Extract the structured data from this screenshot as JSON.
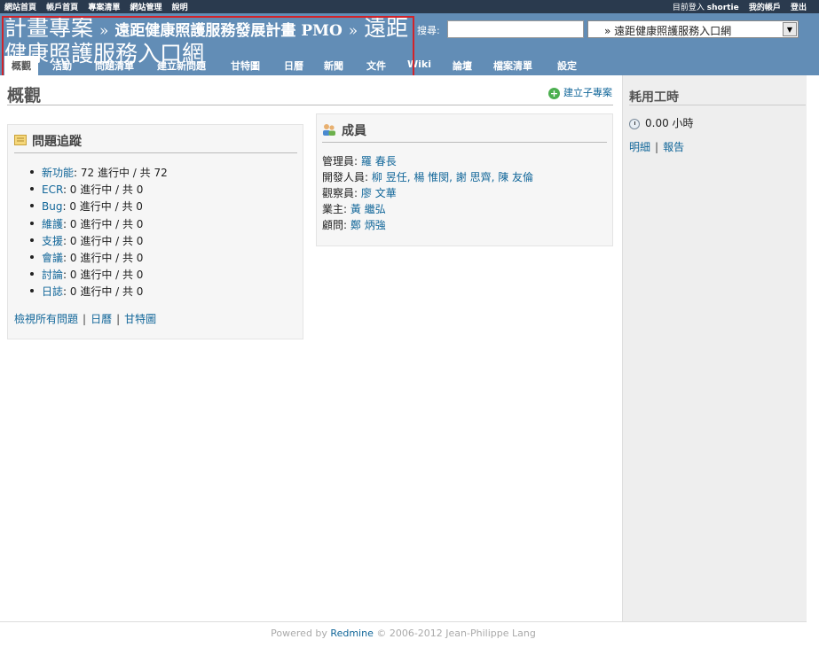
{
  "top_menu": {
    "left": [
      "網站首頁",
      "帳戶首頁",
      "專案清單",
      "網站管理",
      "說明"
    ],
    "logged_in_label": "目前登入",
    "username": "shortie",
    "my_account": "我的帳戶",
    "sign_out": "登出"
  },
  "header": {
    "breadcrumb_root": "計畫專案",
    "separator_1": "»",
    "parent_project": "遠距健康照護服務發展計畫 PMO",
    "separator_2": "»",
    "current_project": "遠距健康照護服務入口網",
    "search_label": "搜尋:",
    "search_value": "",
    "project_jump_value": "» 遠距健康照護服務入口網",
    "jump_arrow": "▼"
  },
  "tabs": [
    "概觀",
    "活動",
    "問題清單",
    "建立新問題",
    "甘特圖",
    "日曆",
    "新聞",
    "文件",
    "Wiki",
    "論壇",
    "檔案清單",
    "設定"
  ],
  "main": {
    "title": "概觀",
    "new_subproject": "建立子專案",
    "issues": {
      "heading": "問題追蹤",
      "items": [
        {
          "tracker": "新功能",
          "text": ": 72 進行中 / 共 72"
        },
        {
          "tracker": "ECR",
          "text": ": 0 進行中 / 共 0"
        },
        {
          "tracker": "Bug",
          "text": ": 0 進行中 / 共 0"
        },
        {
          "tracker": "維護",
          "text": ": 0 進行中 / 共 0"
        },
        {
          "tracker": "支援",
          "text": ": 0 進行中 / 共 0"
        },
        {
          "tracker": "會議",
          "text": ": 0 進行中 / 共 0"
        },
        {
          "tracker": "討論",
          "text": ": 0 進行中 / 共 0"
        },
        {
          "tracker": "日誌",
          "text": ": 0 進行中 / 共 0"
        }
      ],
      "links": [
        "檢視所有問題",
        "日曆",
        "甘特圖"
      ],
      "link_separator": "|"
    },
    "members": {
      "heading": "成員",
      "rows": [
        {
          "role": "管理員:",
          "names": "羅 春長"
        },
        {
          "role": "開發人員:",
          "names": "柳 昱任, 楊 惟閔, 謝 思齊, 陳 友倫"
        },
        {
          "role": "觀察員:",
          "names": "廖 文華"
        },
        {
          "role": "業主:",
          "names": "黃 繼弘"
        },
        {
          "role": "顧問:",
          "names": "鄭 炳強"
        }
      ]
    }
  },
  "sidebar": {
    "heading": "耗用工時",
    "hours": "0.00 小時",
    "links": [
      "明細",
      "報告"
    ],
    "link_separator": "|"
  },
  "footer": {
    "powered_by": "Powered by",
    "product": "Redmine",
    "copyright": "© 2006-2012 Jean-Philippe Lang"
  },
  "colors": {
    "header_bg": "#628db6",
    "top_menu_bg": "#2a3a4e",
    "link": "#169",
    "highlight_border": "#d2232a"
  }
}
